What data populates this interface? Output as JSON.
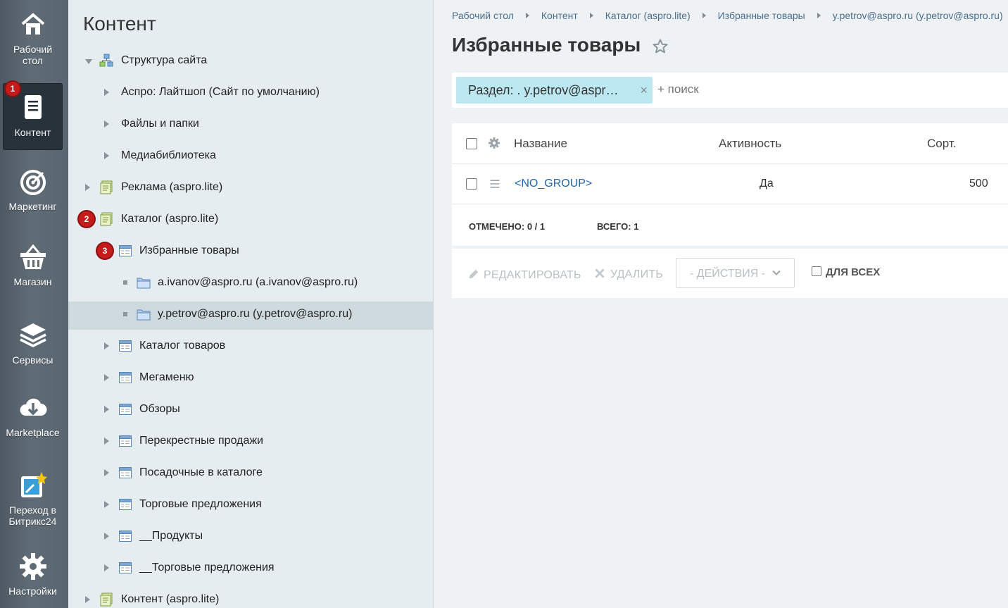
{
  "rail": {
    "items": [
      {
        "label": "Рабочий стол",
        "icon": "home-icon"
      },
      {
        "label": "Контент",
        "icon": "document-icon",
        "badge": "1",
        "active": true
      },
      {
        "label": "Маркетинг",
        "icon": "target-icon"
      },
      {
        "label": "Магазин",
        "icon": "basket-icon"
      },
      {
        "label": "Сервисы",
        "icon": "layers-icon"
      },
      {
        "label": "Marketplace",
        "icon": "cloud-download-icon"
      },
      {
        "label": "Переход в Битрикс24",
        "icon": "bitrix24-icon"
      },
      {
        "label": "Настройки",
        "icon": "gear-icon"
      }
    ]
  },
  "tree": {
    "title": "Контент",
    "nodes": [
      {
        "label": "Структура сайта",
        "badge": ""
      },
      {
        "label": "Аспро: Лайтшоп (Сайт по умолчанию)"
      },
      {
        "label": "Файлы и папки"
      },
      {
        "label": "Медиабиблиотека"
      },
      {
        "label": "Реклама (aspro.lite)"
      },
      {
        "label": "Каталог (aspro.lite)",
        "badge": "2"
      },
      {
        "label": "Избранные товары",
        "badge": "3"
      },
      {
        "label": "a.ivanov@aspro.ru (a.ivanov@aspro.ru)"
      },
      {
        "label": "y.petrov@aspro.ru (y.petrov@aspro.ru)"
      },
      {
        "label": "Каталог товаров"
      },
      {
        "label": "Мегаменю"
      },
      {
        "label": "Обзоры"
      },
      {
        "label": "Перекрестные продажи"
      },
      {
        "label": "Посадочные в каталоге"
      },
      {
        "label": "Торговые предложения"
      },
      {
        "label": "__Продукты"
      },
      {
        "label": "__Торговые предложения"
      },
      {
        "label": "Контент (aspro.lite)"
      }
    ]
  },
  "breadcrumb": [
    "Рабочий стол",
    "Контент",
    "Каталог (aspro.lite)",
    "Избранные товары",
    "y.petrov@aspro.ru (y.petrov@aspro.ru)"
  ],
  "page": {
    "title": "Избранные товары"
  },
  "filter": {
    "chip": "Раздел: . y.petrov@aspr…",
    "chip_close": "×",
    "search_placeholder": "+ поиск"
  },
  "grid": {
    "columns": {
      "name": "Название",
      "active": "Активность",
      "sort": "Сорт."
    },
    "rows": [
      {
        "name": "<NO_GROUP>",
        "active": "Да",
        "sort": "500"
      }
    ],
    "footer": {
      "selected_label": "ОТМЕЧЕНО:",
      "selected_value": "0 / 1",
      "total_label": "ВСЕГО:",
      "total_value": "1"
    }
  },
  "actions": {
    "edit": "РЕДАКТИРОВАТЬ",
    "delete": "УДАЛИТЬ",
    "select": "- ДЕЙСТВИЯ -",
    "for_all": "ДЛЯ ВСЕХ"
  },
  "colors": {
    "rail_bg": "#5f6b75",
    "tree_bg": "#e6edf0",
    "chip_bg": "#bce8f1",
    "link": "#2067b0",
    "badge": "#c51b1b"
  }
}
